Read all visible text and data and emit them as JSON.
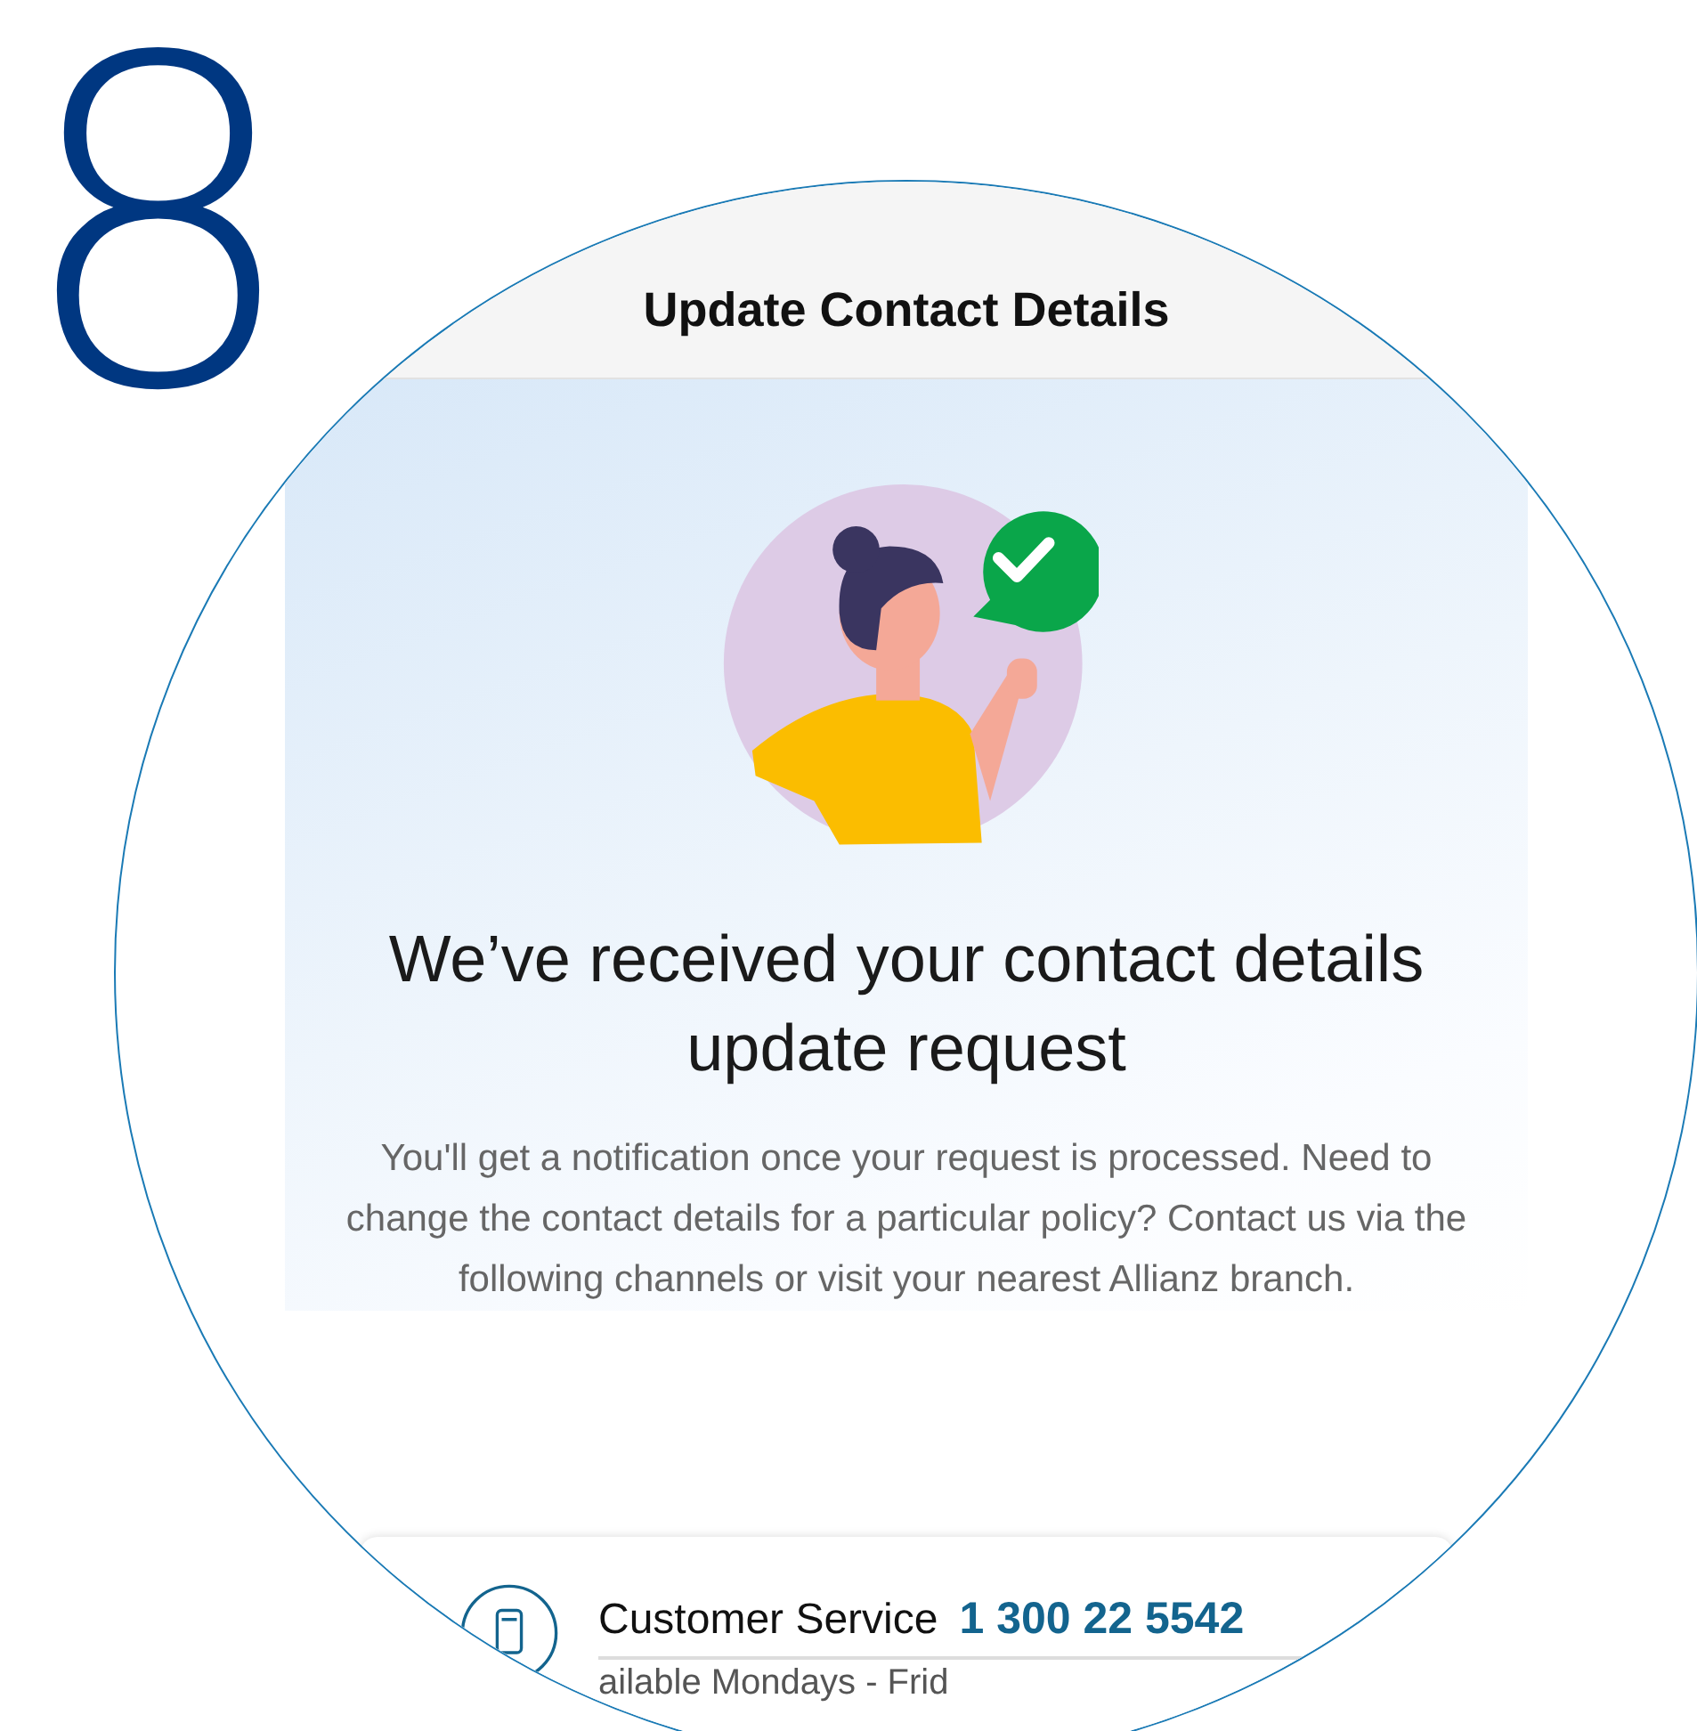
{
  "step_number": "8",
  "header": {
    "title": "Update Contact Details"
  },
  "confirmation": {
    "heading": "We’ve received your contact details update request",
    "message": "You'll get a notification once your request is processed. Need to change the contact details for a particular policy? Contact us via the following channels or visit your nearest Allianz branch."
  },
  "contact_card": {
    "label": "Customer Service",
    "phone": "1 300 22 5542",
    "hours": "ailable Mondays - Frid"
  }
}
